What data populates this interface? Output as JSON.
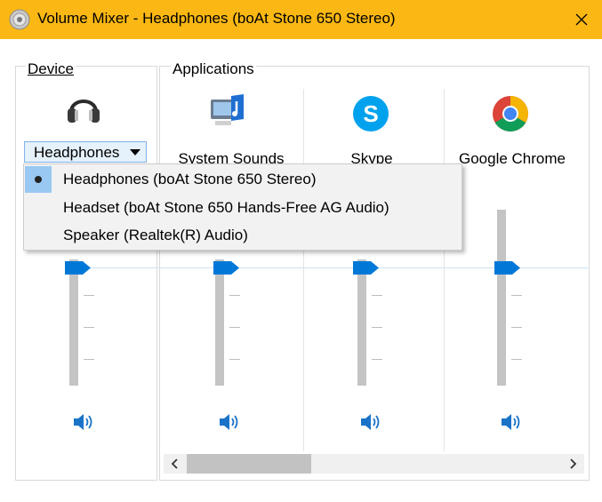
{
  "window": {
    "title": "Volume Mixer - Headphones (boAt Stone 650 Stereo)"
  },
  "device": {
    "section_label": "Device",
    "selected_device": "Headphones",
    "dropdown_items": [
      {
        "label": "Headphones (boAt Stone 650 Stereo)",
        "selected": true
      },
      {
        "label": "Headset (boAt Stone 650 Hands-Free AG Audio)",
        "selected": false
      },
      {
        "label": "Speaker (Realtek(R) Audio)",
        "selected": false
      }
    ],
    "volume_percent": 100
  },
  "applications": {
    "section_label": "Applications",
    "apps": [
      {
        "name": "System Sounds",
        "icon": "system-sounds-icon",
        "volume_percent": 100
      },
      {
        "name": "Skype",
        "icon": "skype-icon",
        "volume_percent": 100
      },
      {
        "name": "Google Chrome",
        "icon": "chrome-icon",
        "volume_percent": 100
      }
    ]
  },
  "colors": {
    "title_bar": "#fbb814",
    "accent": "#0078d7"
  }
}
